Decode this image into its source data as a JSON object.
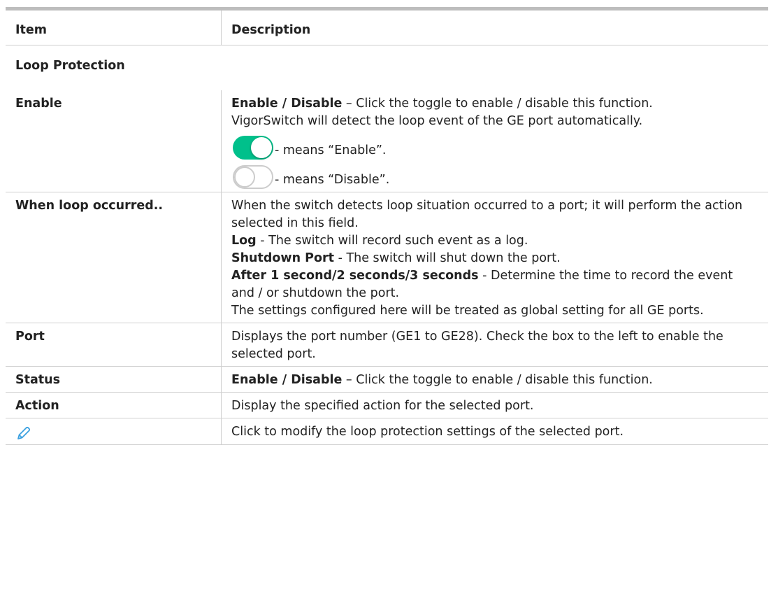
{
  "header": {
    "item": "Item",
    "description": "Description"
  },
  "section": "Loop Protection",
  "enable": {
    "label": "Enable",
    "bold": "Enable / Disable",
    "text": " – Click the toggle to enable / disable this function.",
    "text2": "VigorSwitch will detect the loop event of the GE port automatically.",
    "on_text": " - means “Enable”.",
    "off_text": " - means “Disable”.",
    "toggle_on_color": "#00c08b"
  },
  "loop": {
    "label": "When loop occurred..",
    "line1": "When the switch detects loop situation occurred to a port; it will perform the action selected in this field.",
    "log_bold": "Log",
    "log_text": " - The switch will record such event as a log.",
    "shutdown_bold": "Shutdown Port",
    "shutdown_text": " - The switch will shut down the port.",
    "after_bold": "After 1 second/2 seconds/3 seconds",
    "after_text": " - Determine the time to record the event and / or shutdown the port.",
    "global_text": "The settings configured here will be treated as global setting for all GE ports."
  },
  "port": {
    "label": "Port",
    "text": "Displays the port number (GE1 to GE28). Check the box to the left to enable the selected port."
  },
  "status": {
    "label": "Status",
    "bold": "Enable / Disable",
    "text": " – Click the toggle to enable / disable this function."
  },
  "action": {
    "label": "Action",
    "text": "Display the specified action for the selected port."
  },
  "edit": {
    "icon": "pencil-icon",
    "text": "Click to modify the loop protection settings of the selected port.",
    "icon_color": "#3aa0e0"
  }
}
